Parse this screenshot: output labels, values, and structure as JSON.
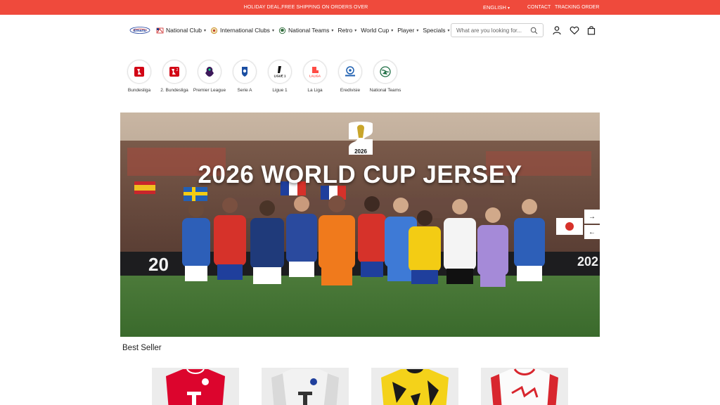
{
  "topbar": {
    "promo": "HOLIDAY DEAL,FREE SHIPPING ON ORDERS OVER",
    "language": "ENGLISH",
    "contact": "CONTACT",
    "tracking": "TRACKING ORDER",
    "bg_color": "#ef4a3c"
  },
  "header": {
    "logo_icon": "brand-logo",
    "nav": [
      {
        "label": "National Club",
        "icon": "club-flag-icon"
      },
      {
        "label": "International Clubs",
        "icon": "globe-icon"
      },
      {
        "label": "National Teams",
        "icon": "ball-icon"
      },
      {
        "label": "Retro",
        "icon": ""
      },
      {
        "label": "World Cup",
        "icon": ""
      },
      {
        "label": "Player",
        "icon": ""
      },
      {
        "label": "Specials",
        "icon": ""
      }
    ],
    "search_placeholder": "What are you looking for...",
    "icons": [
      "user-icon",
      "heart-icon",
      "bag-icon"
    ]
  },
  "leagues": [
    {
      "name": "Bundesliga"
    },
    {
      "name": "2. Bundesliga"
    },
    {
      "name": "Premier League"
    },
    {
      "name": "Serie A"
    },
    {
      "name": "Ligue 1"
    },
    {
      "name": "La Liga"
    },
    {
      "name": "Eredivisie"
    },
    {
      "name": "National Teams"
    }
  ],
  "banner": {
    "headline": "2026 WORLD CUP JERSEY",
    "logo_text": "2026"
  },
  "best_seller": {
    "title": "Best Seller"
  }
}
